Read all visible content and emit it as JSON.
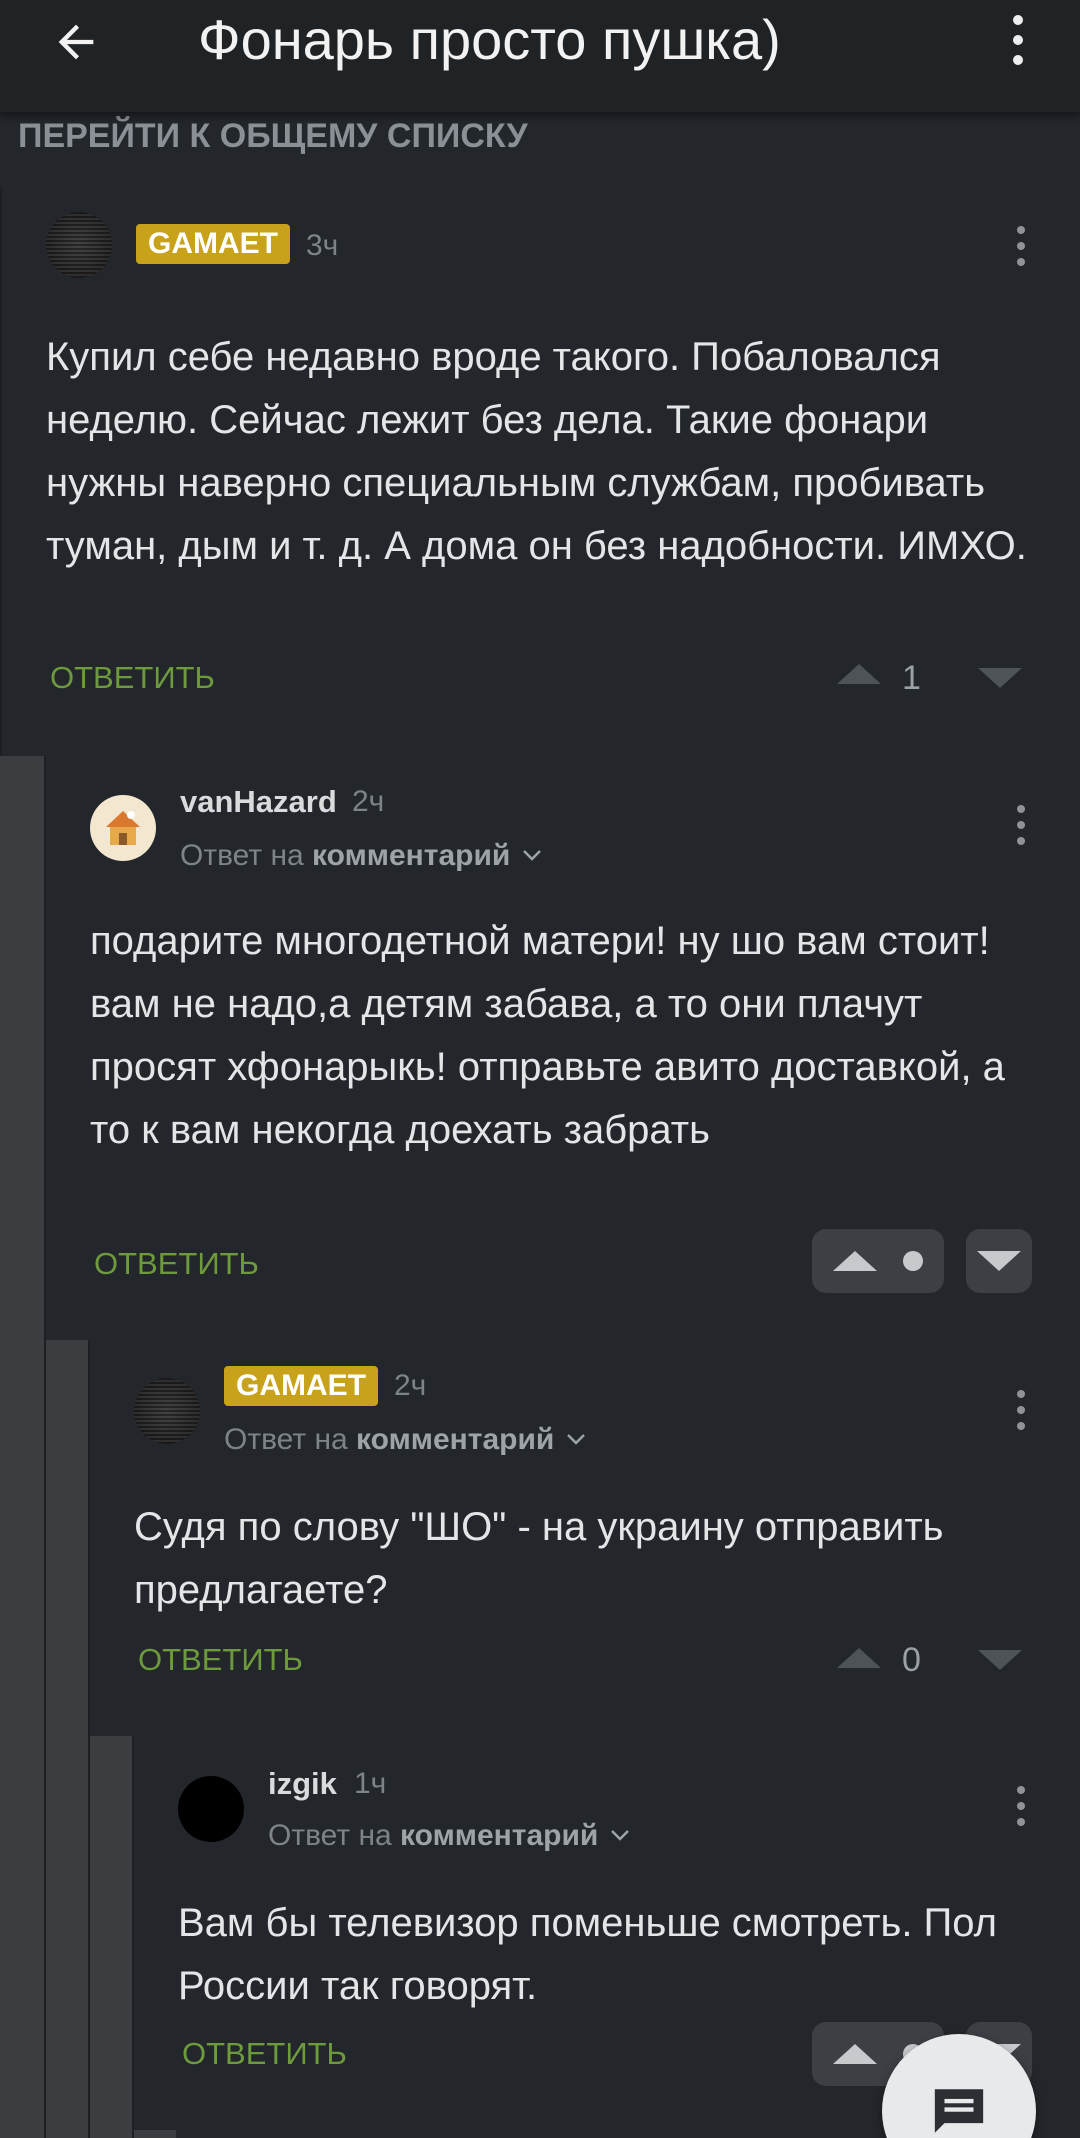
{
  "header": {
    "title": "Фонарь просто пушка)",
    "back_icon": "arrow-left-icon",
    "menu_icon": "more-vertical-icon"
  },
  "go_to_list": "ПЕРЕЙТИ К ОБЩЕМУ СПИСКУ",
  "colors": {
    "background": "#23272b",
    "header": "#1f2326",
    "accent_green": "#6e9a3e",
    "badge_gold": "#c7a21a"
  },
  "comments": [
    {
      "username": "GAMAET",
      "is_badge": true,
      "time": "3ч",
      "text": "Купил себе недавно вроде такого. Побаловался неделю. Сейчас лежит без дела. Такие фонари нужны наверно специальным службам, пробивать туман, дым и т. д. А дома он без надобности. ИМХО.",
      "reply_label": "ОТВЕТИТЬ",
      "rating": "1"
    },
    {
      "username": "vanHazard",
      "time": "2ч",
      "reply_to_prefix": "Ответ на",
      "reply_to_target": "комментарий",
      "text": "подарите многодетной матери! ну шо вам стоит! вам не надо,а детям забава, а то они плачут просят хфонарыкь! отправьте авито доставкой, а то к вам некогда доехать забрать",
      "reply_label": "ОТВЕТИТЬ"
    },
    {
      "username": "GAMAET",
      "is_badge": true,
      "time": "2ч",
      "reply_to_prefix": "Ответ на",
      "reply_to_target": "комментарий",
      "text": "Судя по слову \"ШО\" - на украину отправить предлагаете?",
      "reply_label": "ОТВЕТИТЬ",
      "rating": "0"
    },
    {
      "username": "izgik",
      "time": "1ч",
      "reply_to_prefix": "Ответ на",
      "reply_to_target": "комментарий",
      "text": "Вам бы телевизор поменьше смотреть. Пол России так говорят.",
      "reply_label": "ОТВЕТИТЬ"
    }
  ],
  "fab_icon": "comment-icon"
}
